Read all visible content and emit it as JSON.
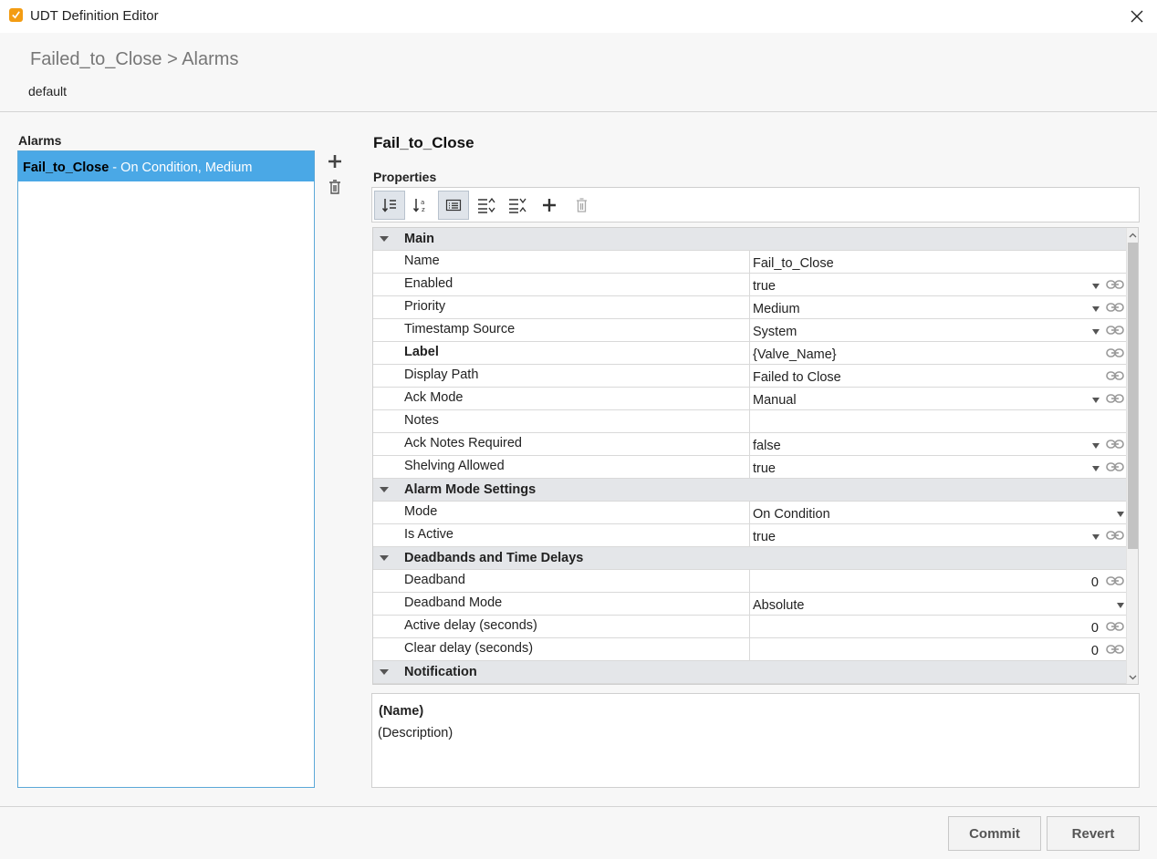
{
  "window": {
    "title": "UDT Definition Editor",
    "icon": "udt-editor-icon",
    "close_icon": "close-icon"
  },
  "header": {
    "breadcrumb": "Failed_to_Close > Alarms",
    "subtitle": "default"
  },
  "alarms": {
    "label": "Alarms",
    "items": [
      {
        "name": "Fail_to_Close",
        "detail": " - On Condition, Medium"
      }
    ],
    "add_icon": "plus-icon",
    "delete_icon": "trash-icon"
  },
  "editor": {
    "title": "Fail_to_Close",
    "properties_label": "Properties",
    "toolbar": [
      {
        "icon": "sort-categorized-icon",
        "active": true
      },
      {
        "icon": "sort-alphabetical-icon",
        "active": false
      },
      {
        "icon": "description-panel-icon",
        "active": true
      },
      {
        "icon": "expand-all-icon",
        "active": false
      },
      {
        "icon": "collapse-all-icon",
        "active": false
      },
      {
        "icon": "add-property-icon",
        "active": false
      },
      {
        "icon": "delete-property-icon",
        "active": false
      }
    ],
    "categories": [
      {
        "name": "Main",
        "props": [
          {
            "name": "Name",
            "value": "Fail_to_Close",
            "dropdown": false,
            "link": false
          },
          {
            "name": "Enabled",
            "value": "true",
            "dropdown": true,
            "link": true
          },
          {
            "name": "Priority",
            "value": "Medium",
            "dropdown": true,
            "link": true
          },
          {
            "name": "Timestamp Source",
            "value": "System",
            "dropdown": true,
            "link": true
          },
          {
            "name": "Label",
            "value": "{Valve_Name}",
            "dropdown": false,
            "link": true,
            "bold": true
          },
          {
            "name": "Display Path",
            "value": "Failed to Close",
            "dropdown": false,
            "link": true
          },
          {
            "name": "Ack Mode",
            "value": "Manual",
            "dropdown": true,
            "link": true
          },
          {
            "name": "Notes",
            "value": "",
            "dropdown": false,
            "link": false
          },
          {
            "name": "Ack Notes Required",
            "value": "false",
            "dropdown": true,
            "link": true
          },
          {
            "name": "Shelving Allowed",
            "value": "true",
            "dropdown": true,
            "link": true
          }
        ]
      },
      {
        "name": "Alarm Mode Settings",
        "props": [
          {
            "name": "Mode",
            "value": "On Condition",
            "dropdown": true,
            "link": false
          },
          {
            "name": "Is Active",
            "value": "true",
            "dropdown": true,
            "link": true
          }
        ]
      },
      {
        "name": "Deadbands and Time Delays",
        "props": [
          {
            "name": "Deadband",
            "value": "0",
            "dropdown": false,
            "link": true,
            "numeric": true
          },
          {
            "name": "Deadband Mode",
            "value": "Absolute",
            "dropdown": true,
            "link": false
          },
          {
            "name": "Active delay (seconds)",
            "value": "0",
            "dropdown": false,
            "link": true,
            "numeric": true
          },
          {
            "name": "Clear delay (seconds)",
            "value": "0",
            "dropdown": false,
            "link": true,
            "numeric": true
          }
        ]
      },
      {
        "name": "Notification",
        "props": []
      }
    ],
    "description": {
      "name": "(Name)",
      "text": "(Description)"
    }
  },
  "footer": {
    "commit": "Commit",
    "revert": "Revert"
  }
}
